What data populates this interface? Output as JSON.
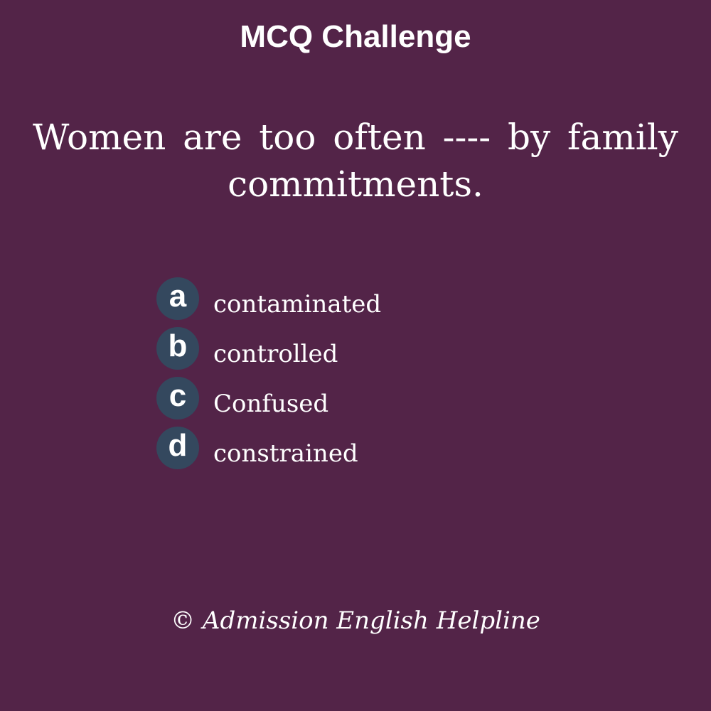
{
  "header": {
    "title": "MCQ Challenge"
  },
  "question": {
    "text": "Women are too often ---- by family commitments."
  },
  "options": [
    {
      "letter": "a",
      "text": "contaminated"
    },
    {
      "letter": "b",
      "text": "controlled"
    },
    {
      "letter": "c",
      "text": "Confused"
    },
    {
      "letter": "d",
      "text": "constrained"
    }
  ],
  "footer": {
    "copyright": "© Admission English Helpline"
  },
  "colors": {
    "background": "#532448",
    "badge": "#34485e",
    "text": "#ffffff"
  }
}
